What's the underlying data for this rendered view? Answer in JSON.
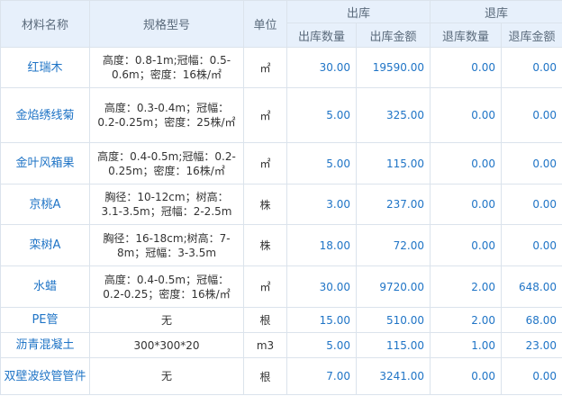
{
  "headers": {
    "name": "材料名称",
    "spec": "规格型号",
    "unit": "单位",
    "out": "出库",
    "ret": "退库",
    "out_qty": "出库数量",
    "out_amt": "出库金额",
    "ret_qty": "退库数量",
    "ret_amt": "退库金额"
  },
  "rows": [
    {
      "name": "红瑞木",
      "spec": "高度：0.8-1m;冠幅：0.5-0.6m；密度：16株/㎡",
      "unit": "㎡",
      "out_qty": "30.00",
      "out_amt": "19590.00",
      "ret_qty": "0.00",
      "ret_amt": "0.00"
    },
    {
      "name": "金焰绣线菊",
      "spec": "高度：0.3-0.4m；冠幅：0.2-0.25m；密度：25株/㎡",
      "unit": "㎡",
      "out_qty": "5.00",
      "out_amt": "325.00",
      "ret_qty": "0.00",
      "ret_amt": "0.00"
    },
    {
      "name": "金叶风箱果",
      "spec": "高度：0.4-0.5m;冠幅：0.2-0.25m；密度：16株/㎡",
      "unit": "㎡",
      "out_qty": "5.00",
      "out_amt": "115.00",
      "ret_qty": "0.00",
      "ret_amt": "0.00"
    },
    {
      "name": "京桃A",
      "spec": "胸径：10-12cm；树高：3.1-3.5m；冠幅：2-2.5m",
      "unit": "株",
      "out_qty": "3.00",
      "out_amt": "237.00",
      "ret_qty": "0.00",
      "ret_amt": "0.00"
    },
    {
      "name": "栾树A",
      "spec": "胸径：16-18cm;树高：7-8m；冠幅：3-3.5m",
      "unit": "株",
      "out_qty": "18.00",
      "out_amt": "72.00",
      "ret_qty": "0.00",
      "ret_amt": "0.00"
    },
    {
      "name": "水蜡",
      "spec": "高度：0.4-0.5m；冠幅：0.2-0.25；密度：16株/㎡",
      "unit": "㎡",
      "out_qty": "30.00",
      "out_amt": "9720.00",
      "ret_qty": "2.00",
      "ret_amt": "648.00"
    },
    {
      "name": "PE管",
      "spec": "无",
      "unit": "根",
      "out_qty": "15.00",
      "out_amt": "510.00",
      "ret_qty": "2.00",
      "ret_amt": "68.00"
    },
    {
      "name": "沥青混凝土",
      "spec": "300*300*20",
      "unit": "m3",
      "out_qty": "5.00",
      "out_amt": "115.00",
      "ret_qty": "1.00",
      "ret_amt": "23.00"
    },
    {
      "name": "双壁波纹管管件",
      "spec": "无",
      "unit": "根",
      "out_qty": "7.00",
      "out_amt": "3241.00",
      "ret_qty": "0.00",
      "ret_amt": "0.00"
    }
  ]
}
